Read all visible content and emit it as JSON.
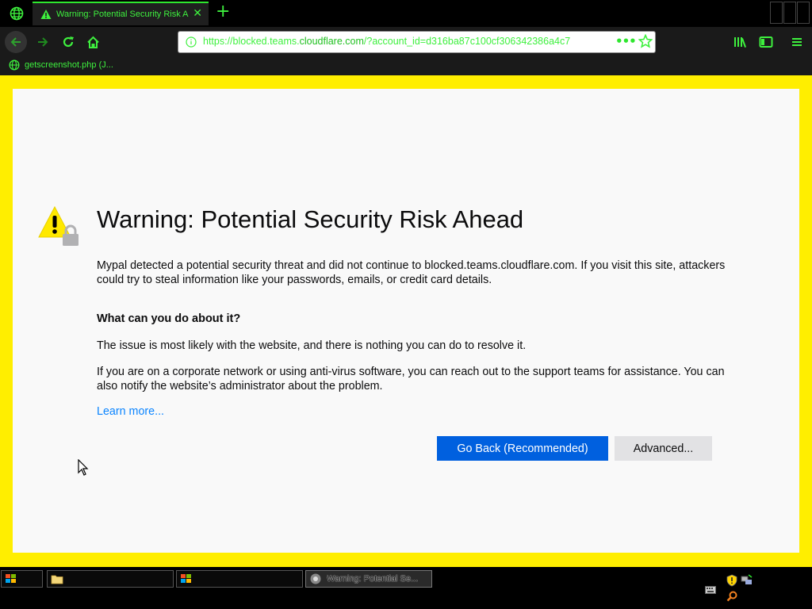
{
  "browser": {
    "tab": {
      "title": "Warning: Potential Security Risk A",
      "close": "✕"
    },
    "new_tab": "+",
    "url": {
      "prefix": "https://blocked.teams.",
      "domain": "cloudflare.com",
      "suffix": "/?account_id=d316ba87c100cf306342386a4c7",
      "more": "•••"
    },
    "bookmark": {
      "label": "getscreenshot.php (J..."
    }
  },
  "page": {
    "title": "Warning: Potential Security Risk Ahead",
    "intro": "Mypal detected a potential security threat and did not continue to blocked.teams.cloudflare.com. If you visit this site, attackers could try to steal information like your passwords, emails, or credit card details.",
    "question": "What can you do about it?",
    "para1": "The issue is most likely with the website, and there is nothing you can do to resolve it.",
    "para2": "If you are on a corporate network or using anti-virus software, you can reach out to the support teams for assistance. You can also notify the website’s administrator about the problem.",
    "learn_more": "Learn more...",
    "go_back": "Go Back (Recommended)",
    "advanced": "Advanced..."
  },
  "taskbar": {
    "active_window": "Warning: Potential Se..."
  },
  "colors": {
    "accent": "#2ee62e",
    "frame": "#ffee00",
    "primary_button": "#0060df",
    "link": "#0a84ff"
  }
}
